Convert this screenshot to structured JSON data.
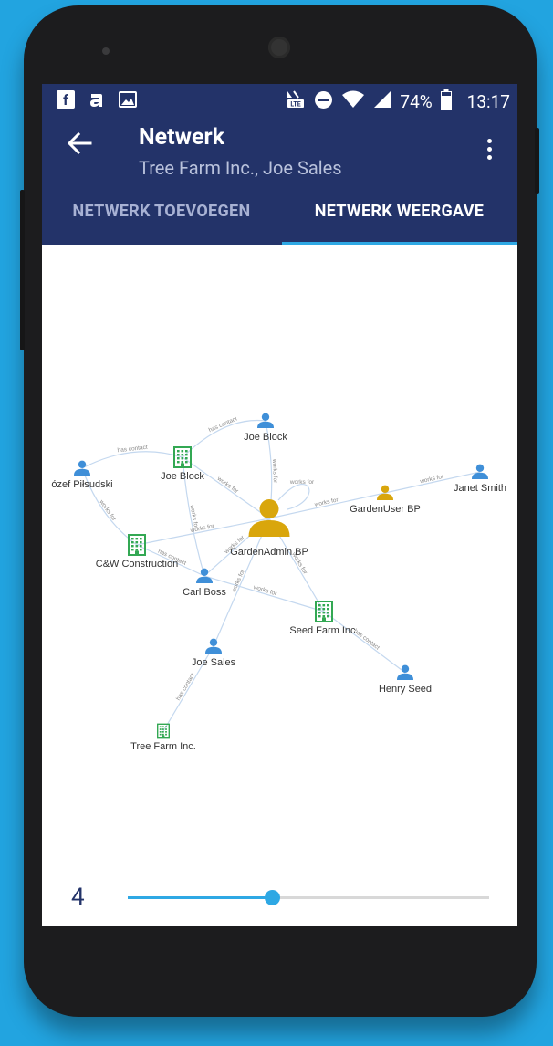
{
  "status_bar": {
    "battery_percent": "74%",
    "time": "13:17",
    "icons": [
      "facebook-icon",
      "app-icon",
      "image-icon",
      "volte-icon",
      "dnd-icon",
      "wifi-icon",
      "signal-icon",
      "battery-icon"
    ]
  },
  "app_bar": {
    "title": "Netwerk",
    "subtitle": "Tree Farm Inc., Joe Sales"
  },
  "tabs": [
    {
      "label": "NETWERK TOEVOEGEN",
      "active": false
    },
    {
      "label": "NETWERK WEERGAVE",
      "active": true
    }
  ],
  "graph": {
    "colors": {
      "person": "#3f8fd8",
      "company": "#33a853",
      "admin": "#d9a60c",
      "edge": "#c4d8ef",
      "edge_label": "#8a8a8a"
    },
    "nodes": [
      {
        "id": "joe-block-top",
        "label": "Joe Block",
        "kind": "person"
      },
      {
        "id": "jozef",
        "label": "ózef Piłsudski",
        "kind": "person"
      },
      {
        "id": "joe-block-co",
        "label": "Joe Block",
        "kind": "company"
      },
      {
        "id": "janet",
        "label": "Janet Smith",
        "kind": "person"
      },
      {
        "id": "gardenuser",
        "label": "GardenUser BP",
        "kind": "admin"
      },
      {
        "id": "gardenadmin",
        "label": "GardenAdmin BP",
        "kind": "admin-large"
      },
      {
        "id": "cw",
        "label": "C&W Construction",
        "kind": "company"
      },
      {
        "id": "carl",
        "label": "Carl Boss",
        "kind": "person"
      },
      {
        "id": "seedfarm",
        "label": "Seed Farm Inc.",
        "kind": "company"
      },
      {
        "id": "joesales",
        "label": "Joe Sales",
        "kind": "person"
      },
      {
        "id": "henry",
        "label": "Henry Seed",
        "kind": "person"
      },
      {
        "id": "treefarm",
        "label": "Tree Farm Inc.",
        "kind": "company"
      }
    ],
    "edges": [
      {
        "from": "joe-block-co",
        "to": "joe-block-top",
        "label": "has contact"
      },
      {
        "from": "jozef",
        "to": "joe-block-co",
        "label": "has contact"
      },
      {
        "from": "joe-block-top",
        "to": "gardenadmin",
        "label": "works for"
      },
      {
        "from": "joe-block-co",
        "to": "gardenadmin",
        "label": "works for"
      },
      {
        "from": "gardenadmin",
        "to": "gardenadmin",
        "label": "works for"
      },
      {
        "from": "jozef",
        "to": "cw",
        "label": "works for"
      },
      {
        "from": "joe-block-co",
        "to": "carl",
        "label": "works for"
      },
      {
        "from": "cw",
        "to": "gardenadmin",
        "label": "works for"
      },
      {
        "from": "gardenadmin",
        "to": "gardenuser",
        "label": "works for"
      },
      {
        "from": "gardenuser",
        "to": "janet",
        "label": "works for"
      },
      {
        "from": "cw",
        "to": "carl",
        "label": "has contact"
      },
      {
        "from": "carl",
        "to": "gardenadmin",
        "label": "works for"
      },
      {
        "from": "carl",
        "to": "seedfarm",
        "label": "works for"
      },
      {
        "from": "gardenadmin",
        "to": "seedfarm",
        "label": "works for"
      },
      {
        "from": "seedfarm",
        "to": "henry",
        "label": "has contact"
      },
      {
        "from": "joesales",
        "to": "gardenadmin",
        "label": "works for"
      },
      {
        "from": "treefarm",
        "to": "joesales",
        "label": "has contact"
      }
    ]
  },
  "depth_slider": {
    "value": "4",
    "fraction": 0.4
  }
}
